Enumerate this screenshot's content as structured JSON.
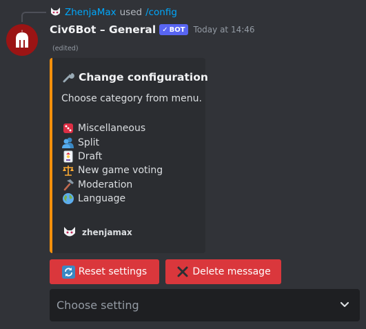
{
  "reply": {
    "username": "ZhenjaMax",
    "used_text": "used",
    "command": "/config"
  },
  "message": {
    "author": "Civ6Bot – General",
    "bot_tag": "BOT",
    "timestamp": "Today at 14:46",
    "edited": "(edited)"
  },
  "embed": {
    "accent_color": "#f4900c",
    "title_icon": "wrench-icon",
    "title": "Change configuration",
    "description": "Choose category from menu.",
    "items": [
      {
        "icon": "dice-icon",
        "label": "Miscellaneous"
      },
      {
        "icon": "users-icon",
        "label": "Split"
      },
      {
        "icon": "joker-card-icon",
        "label": "Draft"
      },
      {
        "icon": "scales-icon",
        "label": "New game voting"
      },
      {
        "icon": "hammer-icon",
        "label": "Moderation"
      },
      {
        "icon": "globe-icon",
        "label": "Language"
      }
    ],
    "footer_author": "zhenjamax"
  },
  "buttons": {
    "reset_label": "Reset settings",
    "reset_icon": "refresh-icon",
    "delete_label": "Delete message",
    "delete_icon": "cross-icon",
    "color": "#da373c"
  },
  "select": {
    "placeholder": "Choose setting"
  }
}
